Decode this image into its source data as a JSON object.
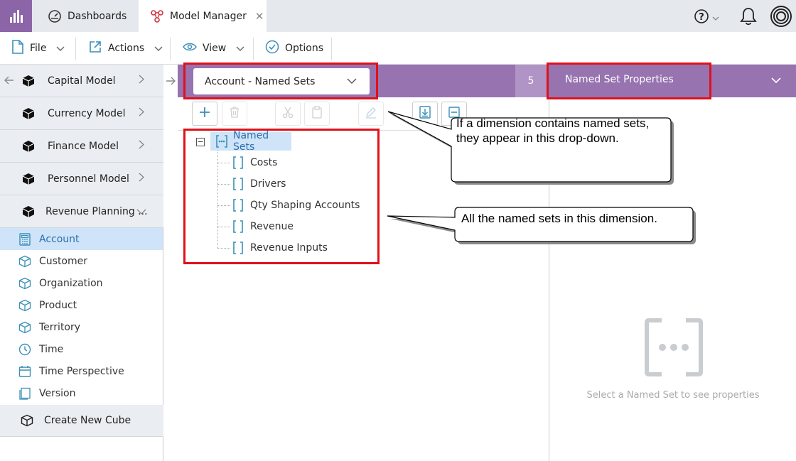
{
  "tabs": [
    {
      "label": "Dashboards"
    },
    {
      "label": "Model Manager",
      "close": "✕"
    }
  ],
  "header": {
    "help": "?"
  },
  "toolbar": {
    "file": "File",
    "actions": "Actions",
    "view": "View",
    "options": "Options"
  },
  "sidebar": {
    "models": [
      {
        "label": "Capital Model"
      },
      {
        "label": "Currency Model"
      },
      {
        "label": "Finance Model"
      },
      {
        "label": "Personnel Model"
      },
      {
        "label": "Revenue Planning ..."
      }
    ],
    "dimensions": [
      {
        "label": "Account",
        "icon": "calculator-icon",
        "active": true
      },
      {
        "label": "Customer",
        "icon": "cube-outline-icon"
      },
      {
        "label": "Organization",
        "icon": "cube-outline-icon"
      },
      {
        "label": "Product",
        "icon": "cube-outline-icon"
      },
      {
        "label": "Territory",
        "icon": "cube-outline-icon"
      },
      {
        "label": "Time",
        "icon": "clock-icon"
      },
      {
        "label": "Time Perspective",
        "icon": "calendar-icon"
      },
      {
        "label": "Version",
        "icon": "pages-icon"
      }
    ],
    "create_cube": "Create New Cube"
  },
  "main": {
    "dropdown_value": "Account - Named Sets",
    "count": "5",
    "properties_title": "Named Set Properties",
    "tree": {
      "root": "Named Sets",
      "items": [
        "Costs",
        "Drivers",
        "Qty Shaping Accounts",
        "Revenue",
        "Revenue Inputs"
      ]
    },
    "empty_message": "Select a Named Set to see properties"
  },
  "callouts": {
    "dropdown_line1": "If a dimension contains named sets,",
    "dropdown_line2": "they appear in this drop-down.",
    "list": "All the named sets in this dimension."
  },
  "colors": {
    "accent_purple": "#9773b0",
    "highlight_red": "#e0101a",
    "selection_blue": "#cfe4f8",
    "icon_teal": "#3a8fb7"
  }
}
